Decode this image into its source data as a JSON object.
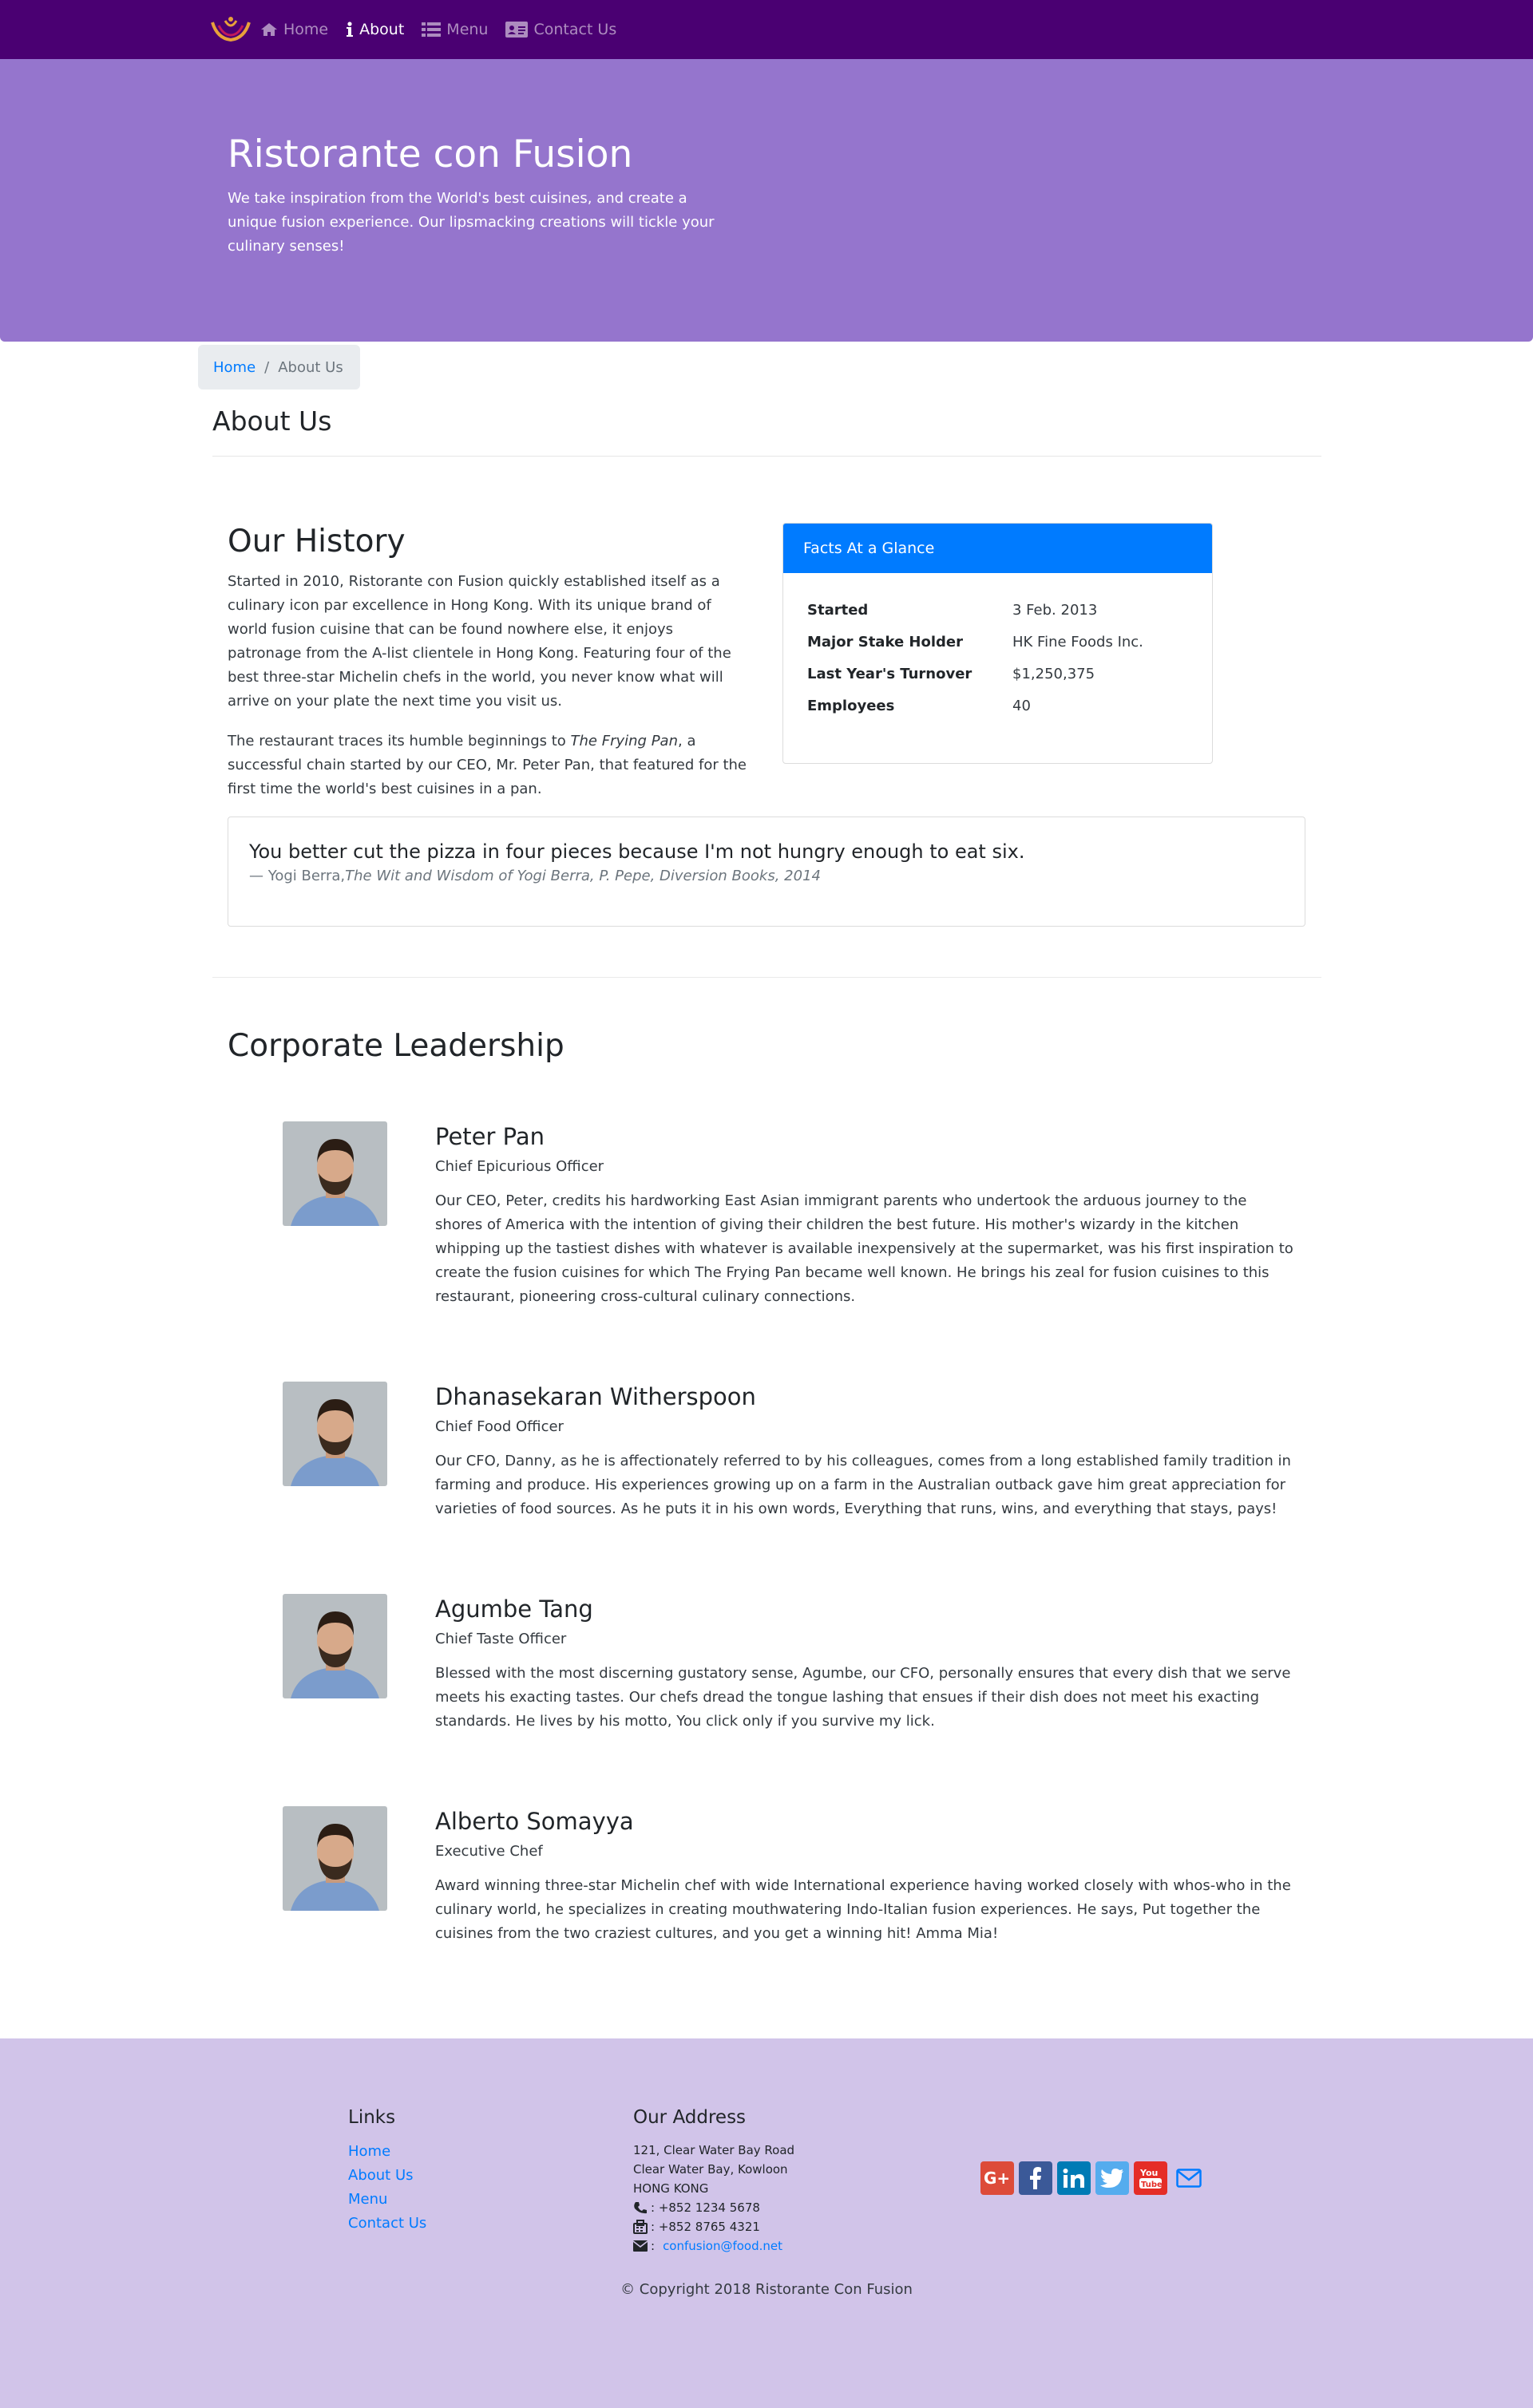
{
  "nav": {
    "items": [
      {
        "label": "Home",
        "icon": "home-icon"
      },
      {
        "label": "About",
        "icon": "info-icon",
        "active": true
      },
      {
        "label": "Menu",
        "icon": "list-icon"
      },
      {
        "label": "Contact Us",
        "icon": "address-card-icon"
      }
    ]
  },
  "jumbotron": {
    "title": "Ristorante con Fusion",
    "text": "We take inspiration from the World's best cuisines, and create a unique fusion experience. Our lipsmacking creations will tickle your culinary senses!"
  },
  "breadcrumb": {
    "home": "Home",
    "current": "About Us"
  },
  "page_title": "About Us",
  "history": {
    "title": "Our History",
    "p1": "Started in 2010, Ristorante con Fusion quickly established itself as a culinary icon par excellence in Hong Kong. With its unique brand of world fusion cuisine that can be found nowhere else, it enjoys patronage from the A-list clientele in Hong Kong. Featuring four of the best three-star Michelin chefs in the world, you never know what will arrive on your plate the next time you visit us.",
    "p2_before": "The restaurant traces its humble beginnings to ",
    "p2_em": "The Frying Pan",
    "p2_after": ", a successful chain started by our CEO, Mr. Peter Pan, that featured for the first time the world's best cuisines in a pan."
  },
  "facts": {
    "header": "Facts At a Glance",
    "rows": [
      {
        "label": "Started",
        "value": "3 Feb. 2013"
      },
      {
        "label": "Major Stake Holder",
        "value": "HK Fine Foods Inc."
      },
      {
        "label": "Last Year's Turnover",
        "value": "$1,250,375"
      },
      {
        "label": "Employees",
        "value": "40"
      }
    ]
  },
  "quote": {
    "text": "You better cut the pizza in four pieces because I'm not hungry enough to eat six.",
    "author": "— Yogi Berra,",
    "cite": "The Wit and Wisdom of Yogi Berra, P. Pepe, Diversion Books, 2014"
  },
  "leadership": {
    "title": "Corporate Leadership",
    "leaders": [
      {
        "name": "Peter Pan",
        "role": "Chief Epicurious Officer",
        "desc": "Our CEO, Peter, credits his hardworking East Asian immigrant parents who undertook the arduous journey to the shores of America with the intention of giving their children the best future. His mother's wizardy in the kitchen whipping up the tastiest dishes with whatever is available inexpensively at the supermarket, was his first inspiration to create the fusion cuisines for which The Frying Pan became well known. He brings his zeal for fusion cuisines to this restaurant, pioneering cross-cultural culinary connections."
      },
      {
        "name": "Dhanasekaran Witherspoon",
        "role": "Chief Food Officer",
        "desc": "Our CFO, Danny, as he is affectionately referred to by his colleagues, comes from a long established family tradition in farming and produce. His experiences growing up on a farm in the Australian outback gave him great appreciation for varieties of food sources. As he puts it in his own words, Everything that runs, wins, and everything that stays, pays!"
      },
      {
        "name": "Agumbe Tang",
        "role": "Chief Taste Officer",
        "desc": "Blessed with the most discerning gustatory sense, Agumbe, our CFO, personally ensures that every dish that we serve meets his exacting tastes. Our chefs dread the tongue lashing that ensues if their dish does not meet his exacting standards. He lives by his motto, You click only if you survive my lick."
      },
      {
        "name": "Alberto Somayya",
        "role": "Executive Chef",
        "desc": "Award winning three-star Michelin chef with wide International experience having worked closely with whos-who in the culinary world, he specializes in creating mouthwatering Indo-Italian fusion experiences. He says, Put together the cuisines from the two craziest cultures, and you get a winning hit! Amma Mia!"
      }
    ]
  },
  "footer": {
    "links_title": "Links",
    "links": [
      "Home",
      "About Us",
      "Menu",
      "Contact Us"
    ],
    "address_title": "Our Address",
    "address_lines": [
      "121, Clear Water Bay Road",
      "Clear Water Bay, Kowloon",
      "HONG KONG"
    ],
    "phone": ": +852 1234 5678",
    "fax": ": +852 8765 4321",
    "email_prefix": ":",
    "email": "confusion@food.net",
    "social": [
      {
        "icon": "google-plus-icon",
        "color": "#dd4b39"
      },
      {
        "icon": "facebook-icon",
        "color": "#3b5998"
      },
      {
        "icon": "linkedin-icon",
        "color": "#007bb5"
      },
      {
        "icon": "twitter-icon",
        "color": "#55acee"
      },
      {
        "icon": "youtube-icon",
        "color": "#e52d27"
      },
      {
        "icon": "envelope-icon",
        "color": "#007bff"
      }
    ],
    "copyright": "© Copyright 2018 Ristorante Con Fusion"
  },
  "colors": {
    "navbar": "#4a0072",
    "jumbotron": "#9575cd",
    "footer": "#d1c4e9",
    "primary": "#007bff"
  }
}
